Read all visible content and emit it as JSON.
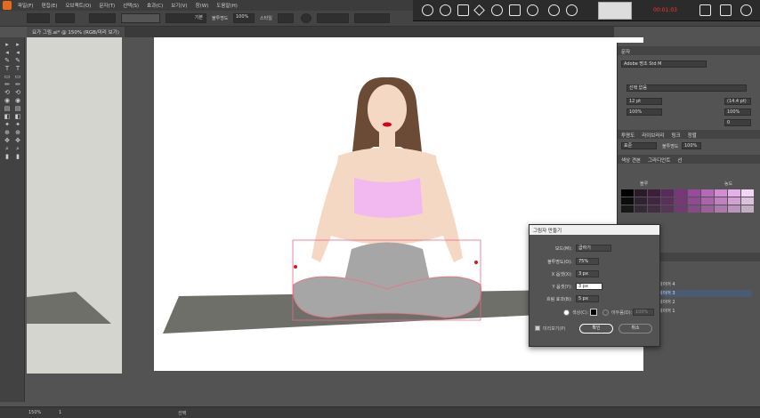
{
  "menu": {
    "items": [
      "파일(F)",
      "편집(E)",
      "오브젝트(O)",
      "문자(T)",
      "선택(S)",
      "효과(C)",
      "보기(V)",
      "창(W)",
      "도움말(H)"
    ]
  },
  "control": {
    "stroke_style": "기본",
    "opacity_label": "불투명도",
    "opacity": "100%",
    "style_label": "스타일"
  },
  "recorder": {
    "timer": "00:01:03"
  },
  "document": {
    "tab": "요가 그림.ai* @ 150% (RGB/미리 보기)"
  },
  "status": {
    "zoom": "150%",
    "page": "1",
    "mode": "선택"
  },
  "panels": {
    "character": {
      "title": "문자",
      "font": "Adobe 명조 Std M",
      "font_style": "선택 없음",
      "size": "12 pt",
      "leading": "(14.4 pt)",
      "scale_v": "100%",
      "scale_h": "100%",
      "tracking": "0"
    },
    "tabs": [
      "투명도",
      "라이브러리",
      "링크",
      "정렬"
    ],
    "blend": "표준",
    "blend_opacity_label": "불투명도",
    "blend_opacity": "100%",
    "swatch_tabs": [
      "색상 견본",
      "그라디언트",
      "선"
    ],
    "swatch_cols": [
      "블루",
      "",
      "",
      "농도"
    ],
    "layers_title": "레이어",
    "layers": [
      "레이어 4",
      "레이어 3",
      "레이어 2",
      "레이어 1"
    ]
  },
  "dialog": {
    "title": "그림자 만들기",
    "mode_label": "모드(M):",
    "mode": "곱하기",
    "opacity_label": "불투명도(O):",
    "opacity": "75%",
    "x_label": "X 옵셋(X):",
    "x": "3 px",
    "y_label": "Y 옵셋(Y):",
    "y": "3 px",
    "blur_label": "흐림 효과(B):",
    "blur": "5 px",
    "color_label": "색상(C):",
    "darkness_label": "어두움(D):",
    "darkness": "100%",
    "preview_label": "미리보기(P)",
    "ok": "확인",
    "cancel": "취소"
  },
  "colors": {
    "accent": "#e07be0",
    "bra": "#f2b8f0",
    "pants": "#a6a6a6",
    "skin": "#f5d8c4",
    "hair": "#6b4a36",
    "mat": "#6e6f69"
  }
}
